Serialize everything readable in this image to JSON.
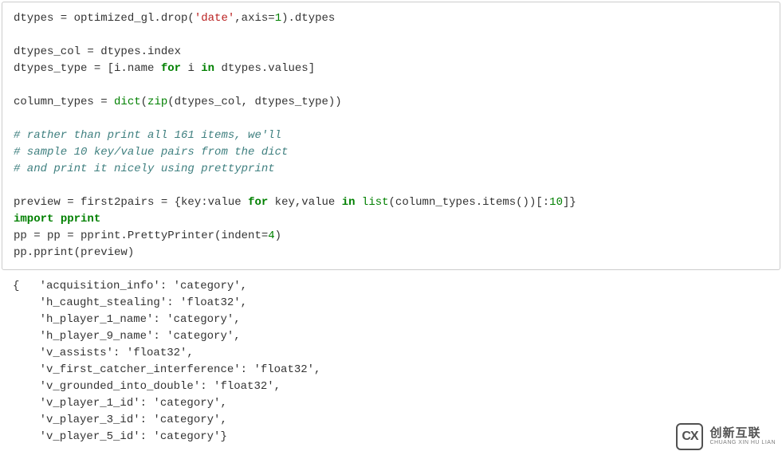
{
  "code": {
    "l1a": "dtypes = optimized_gl.drop(",
    "l1b": "'date'",
    "l1c": ",axis=",
    "l1d": "1",
    "l1e": ").dtypes",
    "blank": "",
    "l3": "dtypes_col = dtypes.index",
    "l4a": "dtypes_type = [i.name ",
    "l4_for": "for",
    "l4_sp1": " i ",
    "l4_in": "in",
    "l4c": " dtypes.values]",
    "l6a": "column_types = ",
    "l6_dict": "dict",
    "l6b": "(",
    "l6_zip": "zip",
    "l6c": "(dtypes_col, dtypes_type))",
    "c1": "# rather than print all 161 items, we'll",
    "c2": "# sample 10 key/value pairs from the dict",
    "c3": "# and print it nicely using prettyprint",
    "l12a": "preview = first2pairs = {key:value ",
    "l12_for": "for",
    "l12b": " key,value ",
    "l12_in": "in",
    "l12c": " ",
    "l12_list": "list",
    "l12d": "(column_types.items())[:",
    "l12_10": "10",
    "l12e": "]}",
    "l13_import": "import",
    "l13b": " ",
    "l13_pprint": "pprint",
    "l14a": "pp = pp = pprint.PrettyPrinter(indent=",
    "l14_4": "4",
    "l14b": ")",
    "l15": "pp.pprint(preview)"
  },
  "output": {
    "l1": "{   'acquisition_info': 'category',",
    "l2": "    'h_caught_stealing': 'float32',",
    "l3": "    'h_player_1_name': 'category',",
    "l4": "    'h_player_9_name': 'category',",
    "l5": "    'v_assists': 'float32',",
    "l6": "    'v_first_catcher_interference': 'float32',",
    "l7": "    'v_grounded_into_double': 'float32',",
    "l8": "    'v_player_1_id': 'category',",
    "l9": "    'v_player_3_id': 'category',",
    "l10": "    'v_player_5_id': 'category'}"
  },
  "watermark": {
    "logo": "CX",
    "cn": "创新互联",
    "en": "CHUANG XIN HU LIAN"
  }
}
